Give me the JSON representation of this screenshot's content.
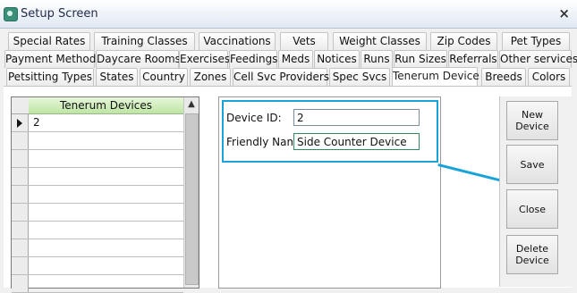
{
  "window": {
    "title": "Setup Screen",
    "close_label": "×"
  },
  "tabs_row1": [
    "Special Rates",
    "Training Classes",
    "Vaccinations",
    "Vets",
    "Weight Classes",
    "Zip Codes",
    "Pet Types"
  ],
  "tabs_row2": [
    "Payment Methods",
    "Daycare Rooms",
    "Exercises",
    "Feedings",
    "Meds",
    "Notices",
    "Runs",
    "Run Sizes",
    "Referrals",
    "Other services"
  ],
  "tabs_row3": [
    "Petsitting Types",
    "States",
    "Country",
    "Zones",
    "Cell Svc Providers",
    "Spec Svcs",
    "Tenerum Device",
    "Breeds",
    "Colors"
  ],
  "active_tab": "Tenerum Device",
  "grid": {
    "header": "Tenerum Devices",
    "rows": [
      "2",
      "",
      "",
      "",
      "",
      "",
      "",
      "",
      "",
      ""
    ]
  },
  "form": {
    "device_id_label": "Device ID:",
    "device_id_value": "2",
    "friendly_name_label": "Friendly Name",
    "friendly_name_value": "Side Counter Device"
  },
  "buttons": {
    "new_device": "New Device",
    "save": "Save",
    "close": "Close",
    "delete_device": "Delete Device"
  },
  "colors": {
    "highlight": "#1aa3d9",
    "header_green": "#bfe5a5"
  }
}
